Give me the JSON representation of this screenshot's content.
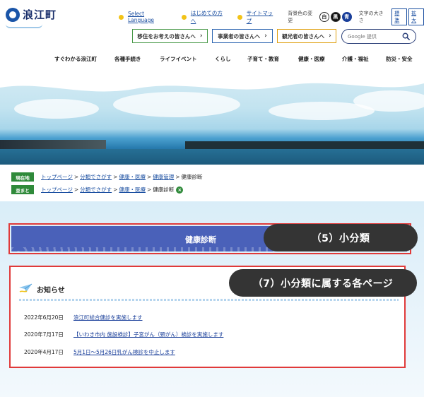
{
  "header": {
    "logo_text": "浪江町",
    "top_links": [
      {
        "label": "Select Language"
      },
      {
        "label": "はじめての方へ"
      },
      {
        "label": "サイトマップ"
      }
    ],
    "bg_color_label": "背景色の変更",
    "bg_colors": [
      {
        "label": "白",
        "color": "#ffffff"
      },
      {
        "label": "黒",
        "color": "#111111"
      },
      {
        "label": "青",
        "color": "#1a3f9a"
      }
    ],
    "font_size_label": "文字の大きさ",
    "font_size_buttons": [
      "標準",
      "拡大"
    ],
    "audience_buttons": [
      {
        "label": "移住をお考えの皆さんへ",
        "accent": "#4a9a4a"
      },
      {
        "label": "事業者の皆さんへ",
        "accent": "#2a64b0"
      },
      {
        "label": "観光者の皆さんへ",
        "accent": "#e0a010"
      }
    ],
    "search_placeholder": "Google 提供"
  },
  "gnav": [
    {
      "label": "すぐわかる浪江町"
    },
    {
      "label": "各種手続き"
    },
    {
      "label": "ライフイベント"
    },
    {
      "label": "くらし"
    },
    {
      "label": "子育て・教育"
    },
    {
      "label": "健康・医療"
    },
    {
      "label": "介護・福祉"
    },
    {
      "label": "防災・安全"
    }
  ],
  "breadcrumbs": {
    "current": {
      "tag": "現在地",
      "items": [
        "トップページ",
        "分類でさがす",
        "健康・医療",
        "健康管理"
      ],
      "last": "健康診断"
    },
    "pinned": {
      "tag": "並まと",
      "items": [
        "トップページ",
        "分類でさがす",
        "健康・医療"
      ],
      "last": "健康診断"
    }
  },
  "page_title": "健康診断",
  "callouts": {
    "subcategory": "（5）小分類",
    "pages": "（7）小分類に属する各ページ"
  },
  "news": {
    "heading": "お知らせ",
    "items": [
      {
        "date": "2022年6月20日",
        "title": "浪江町総合健診を実施します"
      },
      {
        "date": "2020年7月17日",
        "title": "【いわき市内 施設検診】子宮がん（頸がん）検診を実施します"
      },
      {
        "date": "2020年4月17日",
        "title": "5月1日～5月26日乳がん検診を中止します"
      }
    ]
  },
  "colors": {
    "brand_blue": "#1a2f6b",
    "title_band": "#4a61b9",
    "annotation_red": "#e03a3a",
    "breadcrumb_green": "#2f8a3a"
  }
}
